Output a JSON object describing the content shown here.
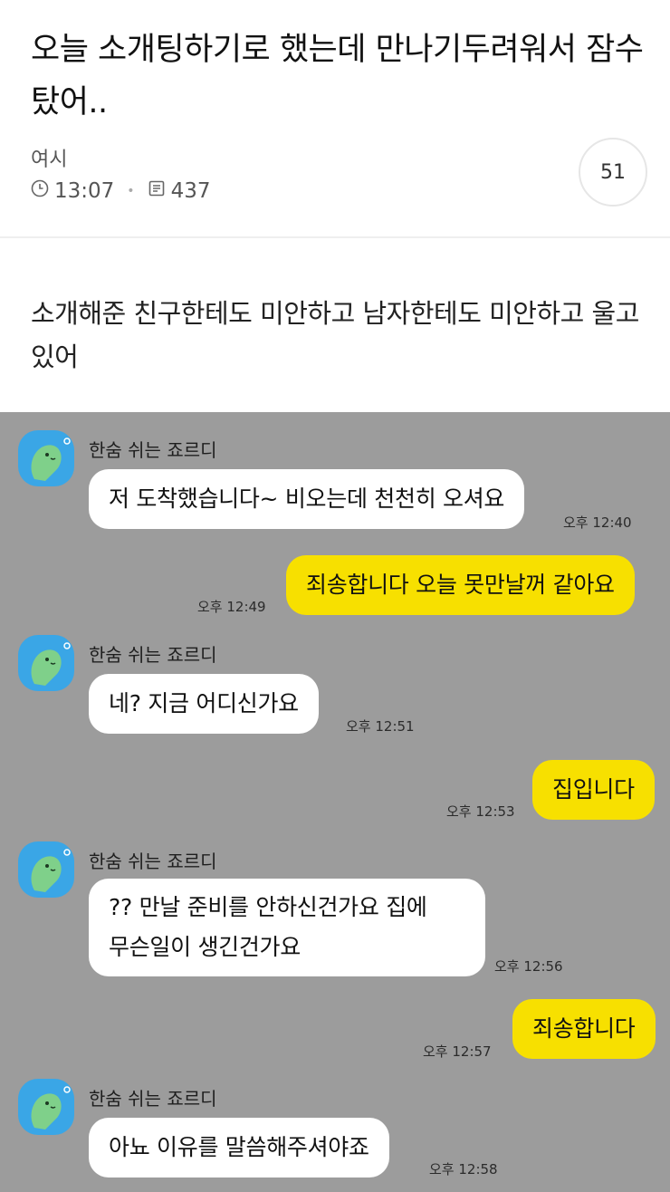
{
  "post": {
    "title": "오늘 소개팅하기로 했는데 만나기두려워서 잠수 탔어..",
    "author": "여시",
    "time": "13:07",
    "views": "437",
    "comment_count": "51",
    "body": "소개해준 친구한테도 미안하고 남자한테도 미안하고 울고있어"
  },
  "chat": {
    "background": "#9c9c9c",
    "incoming_color": "#ffffff",
    "outgoing_color": "#f7e000",
    "messages": [
      {
        "sender": "한숨 쉬는 죠르디",
        "text": "저 도착했습니다~ 비오는데 천천히 오셔요",
        "time": "오후 12:40"
      },
      {
        "text": "죄송합니다 오늘 못만날꺼 같아요",
        "time": "오후 12:49"
      },
      {
        "sender": "한숨 쉬는 죠르디",
        "text": "네? 지금 어디신가요",
        "time": "오후 12:51"
      },
      {
        "text": "집입니다",
        "time": "오후 12:53"
      },
      {
        "sender": "한숨 쉬는 죠르디",
        "line1": "?? 만날 준비를 안하신건가요 집에",
        "line2": "무슨일이 생긴건가요",
        "time": "오후 12:56"
      },
      {
        "text": "죄송합니다",
        "time": "오후 12:57"
      },
      {
        "sender": "한숨 쉬는 죠르디",
        "text": "아뇨 이유를 말씀해주셔야죠",
        "time": "오후 12:58"
      }
    ]
  },
  "icons": {
    "clock": "clock-icon",
    "views": "document-icon",
    "avatar": "jordy-dinosaur-avatar"
  }
}
